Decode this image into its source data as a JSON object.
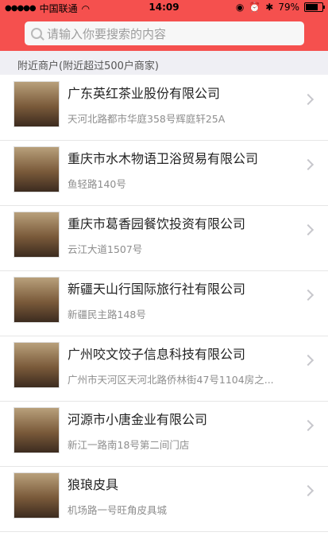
{
  "status": {
    "carrier": "中国联通",
    "time": "14:09",
    "battery": "79%"
  },
  "search": {
    "placeholder": "请输入你要搜索的内容"
  },
  "section": {
    "title": "附近商户(附近超过500户商家)"
  },
  "items": [
    {
      "title": "广东英红茶业股份有限公司",
      "address": "天河北路都市华庭358号辉庭轩25A"
    },
    {
      "title": "重庆市水木物语卫浴贸易有限公司",
      "address": "鱼轻路140号"
    },
    {
      "title": "重庆市葛香园餐饮投资有限公司",
      "address": "云江大道1507号"
    },
    {
      "title": "新疆天山行国际旅行社有限公司",
      "address": "新疆民主路148号"
    },
    {
      "title": "广州咬文饺子信息科技有限公司",
      "address": "广州市天河区天河北路侨林街47号1104房之..."
    },
    {
      "title": "河源市小唐金业有限公司",
      "address": "新江一路南18号第二间门店"
    },
    {
      "title": "狼琅皮具",
      "address": "机场路一号旺角皮具城"
    }
  ]
}
